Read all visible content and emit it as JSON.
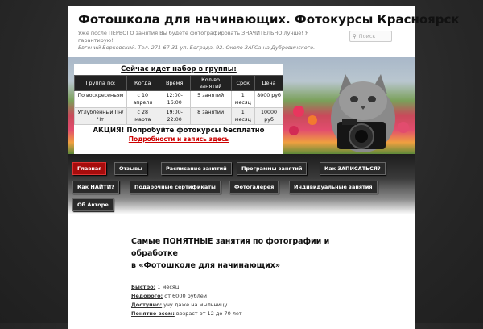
{
  "header": {
    "site_title": "Фотошкола для начинающих. Фотокурсы Красноярск",
    "tagline_1": "Уже после ПЕРВОГО занятия Вы будете фотографировать ЗНАЧИТЕЛЬНО лучше! Я гарантирую!",
    "tagline_2": "Евгений Борковский. Тел. 271-67-31      ул. Бограда, 92. Около ЗАГСа на Дубровинского."
  },
  "search": {
    "placeholder": "Поиск",
    "icon": "search-icon"
  },
  "schedule": {
    "title": "Сейчас идет набор в группы:",
    "headers": [
      "Группа по:",
      "Когда",
      "Время",
      "Кол-во занятий",
      "Срок",
      "Цена"
    ],
    "rows": [
      [
        "По воскресеньям",
        "с 10 апреля",
        "12:00-16:00",
        "5 занятий",
        "1 месяц",
        "8000 руб"
      ],
      [
        "Углубленный Пн/Чт",
        "с 28 марта",
        "19:00-22:00",
        "8 занятий",
        "1 месяц",
        "10000 руб"
      ]
    ],
    "promo": "АКЦИЯ!  Попробуйте фотокурсы бесплатно",
    "promo_link": "Подробности и запись здесь"
  },
  "nav": {
    "items": [
      {
        "label": "Главная",
        "active": true
      },
      {
        "label": "Отзывы"
      },
      {
        "label": "Расписание занятий"
      },
      {
        "label": "Программы занятий"
      },
      {
        "label": "Как ЗАПИСАТЬСЯ?"
      },
      {
        "label": "Как НАЙТИ?"
      },
      {
        "label": "Подарочные сертификаты"
      },
      {
        "label": "Фотогалерея"
      },
      {
        "label": "Индивидуальные занятия"
      },
      {
        "label": "Об Авторе"
      }
    ]
  },
  "content": {
    "headline_1": "Самые ПОНЯТНЫЕ занятия по фотографии и",
    "headline_2": "обработке",
    "headline_3": "в «Фотошколе для начинающих»",
    "facts": [
      {
        "key": "Быстро:",
        "value": " 1 месяц"
      },
      {
        "key": "Недорого:",
        "value": " от 6000 рублей"
      },
      {
        "key": "Доступно:",
        "value": " учу даже на мыльницу"
      },
      {
        "key": "Понятно всем:",
        "value": " возраст от 12 до 70 лет"
      }
    ]
  },
  "colors": {
    "active_nav": "#a70c0c",
    "link_red": "#cc0000",
    "nav_dark": "#2a2a2a"
  }
}
